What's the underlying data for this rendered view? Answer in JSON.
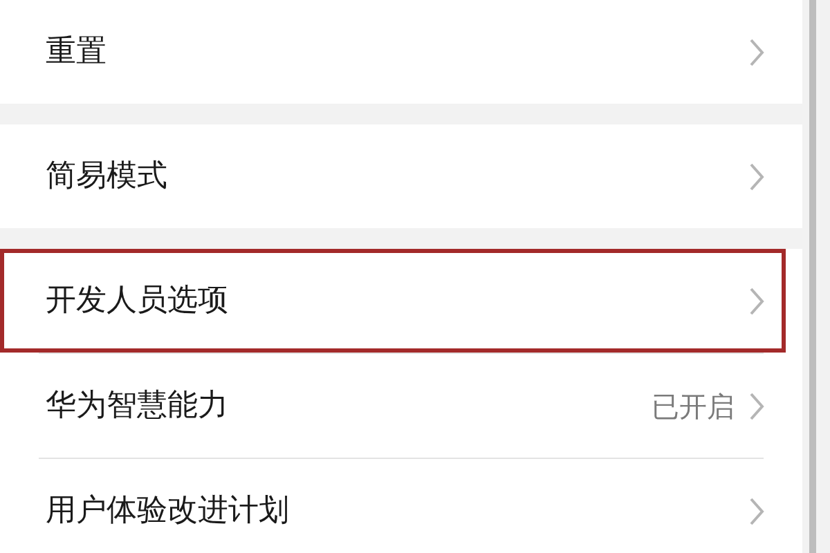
{
  "sections": [
    {
      "items": [
        {
          "label": "重置",
          "highlighted": false
        }
      ]
    },
    {
      "items": [
        {
          "label": "简易模式",
          "highlighted": false
        }
      ]
    },
    {
      "items": [
        {
          "label": "开发人员选项",
          "highlighted": true
        },
        {
          "label": "华为智慧能力",
          "value": "已开启",
          "highlighted": false
        },
        {
          "label": "用户体验改进计划",
          "highlighted": false
        }
      ]
    }
  ]
}
